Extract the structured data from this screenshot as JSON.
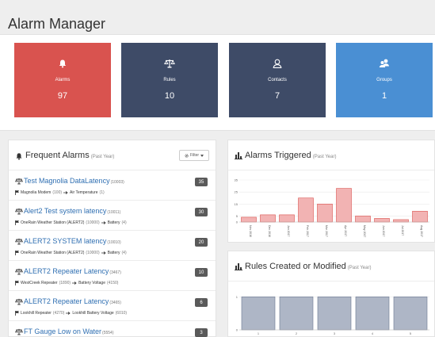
{
  "app": {
    "title": "Alarm Manager"
  },
  "tiles": [
    {
      "label": "Alarms",
      "count": "97",
      "icon": "bell-icon",
      "color": "#d9534f"
    },
    {
      "label": "Rules",
      "count": "10",
      "icon": "scale-icon",
      "color": "#3e4b67"
    },
    {
      "label": "Contacts",
      "count": "7",
      "icon": "user-icon",
      "color": "#3e4b67"
    },
    {
      "label": "Groups",
      "count": "1",
      "icon": "group-icon",
      "color": "#4a8fd3"
    }
  ],
  "frequent_alarms": {
    "title": "Frequent Alarms",
    "subtitle": "(Past Year)",
    "filter_label": "Filter",
    "items": [
      {
        "title": "Test Magnolia DataLatency",
        "id": "(10003)",
        "source": "Magnolia Modem",
        "source_id": "(100)",
        "sensor": "Air Temperature",
        "sensor_id": "(1)",
        "count": "35"
      },
      {
        "title": "Alert2 Test system latency",
        "id": "(10011)",
        "source": "OneRain Weather Station (ALERT2)",
        "source_id": "(10000)",
        "sensor": "Battery",
        "sensor_id": "(4)",
        "count": "30"
      },
      {
        "title": "ALERT2 SYSTEM latency",
        "id": "(10010)",
        "source": "OneRain Weather Station (ALERT2)",
        "source_id": "(10000)",
        "sensor": "Battery",
        "sensor_id": "(4)",
        "count": "20"
      },
      {
        "title": "ALERT2 Repeater Latency",
        "id": "(3467)",
        "source": "WestCreek Repeater",
        "source_id": "(1890)",
        "sensor": "Battery Voltage",
        "sensor_id": "(4150)",
        "count": "10"
      },
      {
        "title": "ALERT2 Repeater Latency",
        "id": "(3465)",
        "source": "Lookhill Repeater",
        "source_id": "(4270)",
        "sensor": "Lookhill Battery Voltage",
        "sensor_id": "(6010)",
        "count": "6"
      },
      {
        "title": "FT Gauge Low on Water",
        "id": "(5554)",
        "source": "",
        "source_id": "",
        "sensor": "",
        "sensor_id": "",
        "count": "3"
      }
    ]
  },
  "alarms_triggered": {
    "title": "Alarms Triggered",
    "subtitle": "(Past Year)",
    "chart_data": {
      "type": "bar",
      "title": "Alarms Triggered",
      "categories": [
        "Nov 2016",
        "Dec 2016",
        "Jan 2017",
        "Feb 2017",
        "Mar 2017",
        "Apr 2017",
        "May 2017",
        "Jun 2017",
        "Jul 2017",
        "Aug 2017"
      ],
      "values": [
        4,
        6,
        6,
        20,
        15,
        28,
        5,
        3,
        2,
        9
      ],
      "yticks": [
        0,
        5,
        15,
        25,
        35
      ],
      "ylim": [
        0,
        35
      ],
      "bar_color": "#f2b3b3",
      "bar_stroke": "#d9534f"
    }
  },
  "rules_created": {
    "title": "Rules Created or Modified",
    "subtitle": "(Past Year)",
    "chart_data": {
      "type": "bar",
      "title": "Rules Created or Modified",
      "categories": [
        "1",
        "2",
        "3",
        "4",
        "5"
      ],
      "values": [
        1,
        1,
        1,
        1,
        1
      ],
      "yticks": [
        0,
        1
      ],
      "ylim": [
        0,
        1.2
      ],
      "bar_color": "#aeb6c6",
      "bar_stroke": "#6d7890"
    }
  }
}
